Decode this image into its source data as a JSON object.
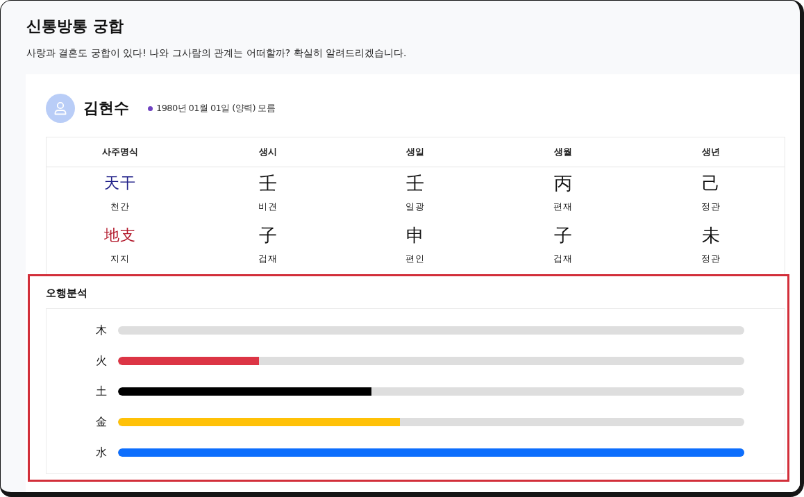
{
  "page": {
    "title": "신통방통 궁합",
    "subtitle": "사랑과 결혼도 궁합이 있다! 나와 그사람의 관계는 어떠할까? 확실히 알려드리겠습니다."
  },
  "profile": {
    "name": "김현수",
    "birth": "1980년 01월 01일 (양력) 모름"
  },
  "saju_table": {
    "columns": [
      "사주명식",
      "생시",
      "생일",
      "생월",
      "생년"
    ],
    "rows": [
      {
        "cells": [
          {
            "char": "天干",
            "reading": "천간",
            "color": "#22228a"
          },
          {
            "char": "壬",
            "reading": "비견"
          },
          {
            "char": "壬",
            "reading": "일광"
          },
          {
            "char": "丙",
            "reading": "편재"
          },
          {
            "char": "己",
            "reading": "정관"
          }
        ]
      },
      {
        "cells": [
          {
            "char": "地支",
            "reading": "지지",
            "color": "#b2182b"
          },
          {
            "char": "子",
            "reading": "겁재"
          },
          {
            "char": "申",
            "reading": "편인"
          },
          {
            "char": "子",
            "reading": "겁재"
          },
          {
            "char": "未",
            "reading": "정관"
          }
        ]
      }
    ]
  },
  "five_elements": {
    "title": "오행분석",
    "highlighted": true,
    "items": [
      {
        "label": "木",
        "level": 0
      },
      {
        "label": "火",
        "level": 0.225,
        "color": "#dc3545"
      },
      {
        "label": "土",
        "level": 0.405,
        "color": "#000000"
      },
      {
        "label": "金",
        "level": 0.45,
        "color": "#ffc107"
      },
      {
        "label": "水",
        "level": 1,
        "color": "#0d6efd"
      }
    ]
  }
}
